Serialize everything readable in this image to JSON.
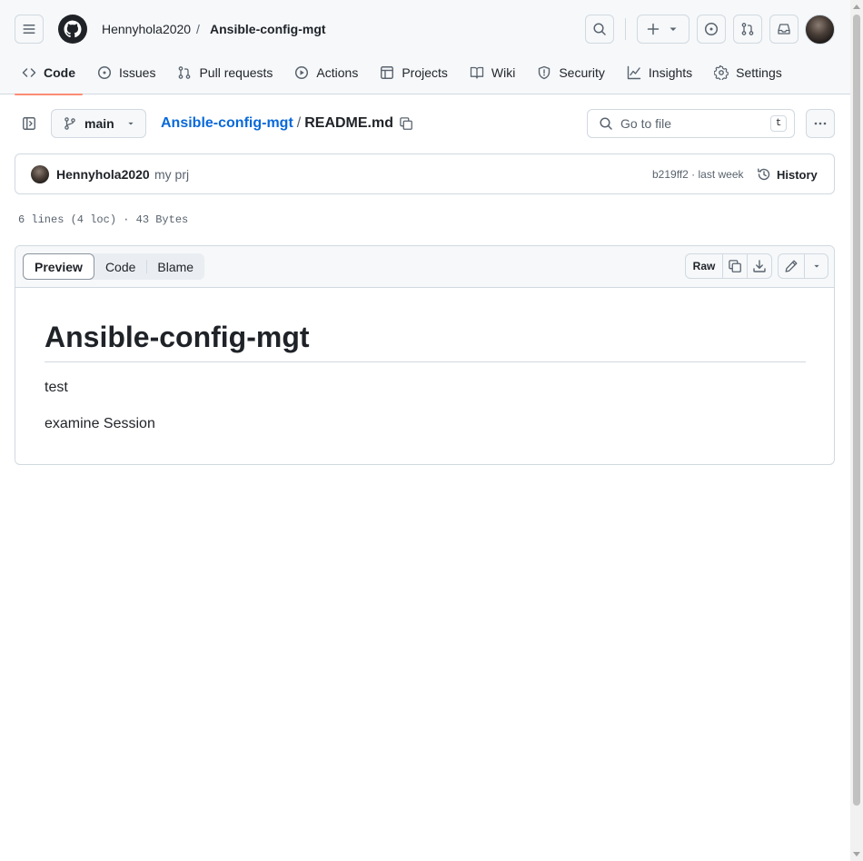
{
  "header": {
    "owner": "Hennyhola2020",
    "separator": "/",
    "repo": "Ansible-config-mgt",
    "icons": [
      "hamburger-icon",
      "github-logo-icon",
      "search-icon",
      "plus-icon",
      "issues-icon",
      "pull-requests-icon",
      "inbox-icon",
      "avatar"
    ]
  },
  "tabs": [
    {
      "label": "Code",
      "icon": "code-icon",
      "active": true
    },
    {
      "label": "Issues",
      "icon": "issues-icon"
    },
    {
      "label": "Pull requests",
      "icon": "pull-request-icon"
    },
    {
      "label": "Actions",
      "icon": "play-icon"
    },
    {
      "label": "Projects",
      "icon": "table-icon"
    },
    {
      "label": "Wiki",
      "icon": "book-icon"
    },
    {
      "label": "Security",
      "icon": "shield-icon"
    },
    {
      "label": "Insights",
      "icon": "graph-icon"
    },
    {
      "label": "Settings",
      "icon": "gear-icon"
    }
  ],
  "file_nav": {
    "branch": "main",
    "path_repo": "Ansible-config-mgt",
    "path_sep": "/",
    "file_name": "README.md",
    "goto_placeholder": "Go to file",
    "goto_shortcut": "t"
  },
  "commit": {
    "author": "Hennyhola2020",
    "message": "my prj",
    "hash_time": "b219ff2 · last week",
    "history_label": "History"
  },
  "file_info": "6 lines (4 loc) · 43 Bytes",
  "viewer": {
    "modes": [
      "Preview",
      "Code",
      "Blame"
    ],
    "selected": "Preview",
    "raw_label": "Raw"
  },
  "readme": {
    "heading": "Ansible-config-mgt",
    "paragraphs": [
      "test",
      "examine Session"
    ]
  },
  "colors": {
    "accent_link": "#0969da",
    "active_tab_underline": "#fd8c73",
    "border": "#d1d9e0",
    "header_bg": "#f6f8fa"
  }
}
